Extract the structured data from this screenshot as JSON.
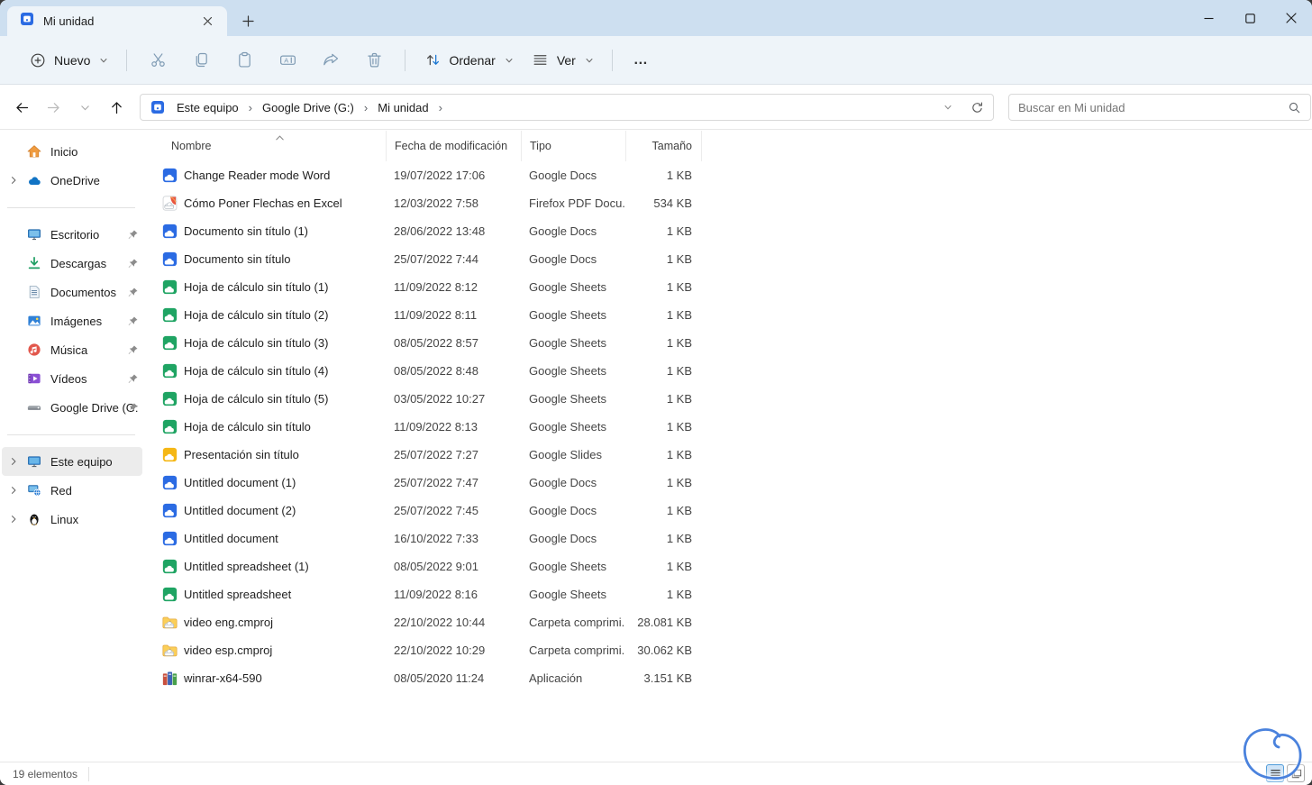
{
  "window": {
    "tab": {
      "title": "Mi unidad"
    },
    "controls": {
      "minimize": "minimize",
      "maximize": "maximize",
      "close": "close"
    }
  },
  "toolbar": {
    "nuevo_label": "Nuevo",
    "ordenar_label": "Ordenar",
    "ver_label": "Ver",
    "more_label": "…",
    "icons": [
      "cut-icon",
      "copy-icon",
      "paste-icon",
      "rename-icon",
      "share-icon",
      "delete-icon"
    ]
  },
  "addressbar": {
    "breadcrumbs": [
      "Este equipo",
      "Google Drive (G:)",
      "Mi unidad"
    ]
  },
  "search": {
    "placeholder": "Buscar en Mi unidad"
  },
  "sidebar": {
    "items": [
      {
        "label": "Inicio",
        "icon": "home",
        "chevron": false,
        "pinned": false
      },
      {
        "label": "OneDrive",
        "icon": "onedrive",
        "chevron": true,
        "pinned": false
      },
      {
        "separator": true
      },
      {
        "label": "Escritorio",
        "icon": "desktop",
        "chevron": false,
        "pinned": true
      },
      {
        "label": "Descargas",
        "icon": "downloads",
        "chevron": false,
        "pinned": true
      },
      {
        "label": "Documentos",
        "icon": "documents",
        "chevron": false,
        "pinned": true
      },
      {
        "label": "Imágenes",
        "icon": "pictures",
        "chevron": false,
        "pinned": true
      },
      {
        "label": "Música",
        "icon": "music",
        "chevron": false,
        "pinned": true
      },
      {
        "label": "Vídeos",
        "icon": "videos",
        "chevron": false,
        "pinned": true
      },
      {
        "label": "Google Drive (G:",
        "icon": "drive",
        "chevron": false,
        "pinned": true
      },
      {
        "separator": true
      },
      {
        "label": "Este equipo",
        "icon": "computer",
        "chevron": true,
        "pinned": false,
        "selected": true
      },
      {
        "label": "Red",
        "icon": "network",
        "chevron": true,
        "pinned": false
      },
      {
        "label": "Linux",
        "icon": "linux",
        "chevron": true,
        "pinned": false
      }
    ]
  },
  "filelist": {
    "columns": {
      "name": "Nombre",
      "date": "Fecha de modificación",
      "type": "Tipo",
      "size": "Tamaño"
    },
    "sort": {
      "column": "Nombre",
      "direction": "ascending"
    },
    "rows": [
      {
        "name": "Change Reader mode Word",
        "date": "19/07/2022 17:06",
        "type": "Google Docs",
        "size": "1 KB",
        "icon": "gdocs"
      },
      {
        "name": "Cómo Poner Flechas en Excel",
        "date": "12/03/2022 7:58",
        "type": "Firefox PDF Docu...",
        "size": "534 KB",
        "icon": "pdf"
      },
      {
        "name": "Documento sin título (1)",
        "date": "28/06/2022 13:48",
        "type": "Google Docs",
        "size": "1 KB",
        "icon": "gdocs"
      },
      {
        "name": "Documento sin título",
        "date": "25/07/2022 7:44",
        "type": "Google Docs",
        "size": "1 KB",
        "icon": "gdocs"
      },
      {
        "name": "Hoja de cálculo sin título (1)",
        "date": "11/09/2022 8:12",
        "type": "Google Sheets",
        "size": "1 KB",
        "icon": "gsheets"
      },
      {
        "name": "Hoja de cálculo sin título (2)",
        "date": "11/09/2022 8:11",
        "type": "Google Sheets",
        "size": "1 KB",
        "icon": "gsheets"
      },
      {
        "name": "Hoja de cálculo sin título (3)",
        "date": "08/05/2022 8:57",
        "type": "Google Sheets",
        "size": "1 KB",
        "icon": "gsheets"
      },
      {
        "name": "Hoja de cálculo sin título (4)",
        "date": "08/05/2022 8:48",
        "type": "Google Sheets",
        "size": "1 KB",
        "icon": "gsheets"
      },
      {
        "name": "Hoja de cálculo sin título (5)",
        "date": "03/05/2022 10:27",
        "type": "Google Sheets",
        "size": "1 KB",
        "icon": "gsheets"
      },
      {
        "name": "Hoja de cálculo sin título",
        "date": "11/09/2022 8:13",
        "type": "Google Sheets",
        "size": "1 KB",
        "icon": "gsheets"
      },
      {
        "name": "Presentación sin título",
        "date": "25/07/2022 7:27",
        "type": "Google Slides",
        "size": "1 KB",
        "icon": "gslides"
      },
      {
        "name": "Untitled document (1)",
        "date": "25/07/2022 7:47",
        "type": "Google Docs",
        "size": "1 KB",
        "icon": "gdocs"
      },
      {
        "name": "Untitled document (2)",
        "date": "25/07/2022 7:45",
        "type": "Google Docs",
        "size": "1 KB",
        "icon": "gdocs"
      },
      {
        "name": "Untitled document",
        "date": "16/10/2022 7:33",
        "type": "Google Docs",
        "size": "1 KB",
        "icon": "gdocs"
      },
      {
        "name": "Untitled spreadsheet (1)",
        "date": "08/05/2022 9:01",
        "type": "Google Sheets",
        "size": "1 KB",
        "icon": "gsheets"
      },
      {
        "name": "Untitled spreadsheet",
        "date": "11/09/2022 8:16",
        "type": "Google Sheets",
        "size": "1 KB",
        "icon": "gsheets"
      },
      {
        "name": "video eng.cmproj",
        "date": "22/10/2022 10:44",
        "type": "Carpeta comprimi...",
        "size": "28.081 KB",
        "icon": "zip"
      },
      {
        "name": "video esp.cmproj",
        "date": "22/10/2022 10:29",
        "type": "Carpeta comprimi...",
        "size": "30.062 KB",
        "icon": "zip"
      },
      {
        "name": "winrar-x64-590",
        "date": "08/05/2020 11:24",
        "type": "Aplicación",
        "size": "3.151 KB",
        "icon": "winrar"
      }
    ]
  },
  "statusbar": {
    "count": "19 elementos"
  },
  "colors": {
    "titlebar": "#cddff0",
    "toolbar": "#eef4f9",
    "accent": "#1976d2",
    "gdocs": "#2b6be3",
    "gsheets": "#1fa463",
    "gslides": "#f5b715",
    "folder": "#fbcf59",
    "annotation": "#4a82dd"
  }
}
